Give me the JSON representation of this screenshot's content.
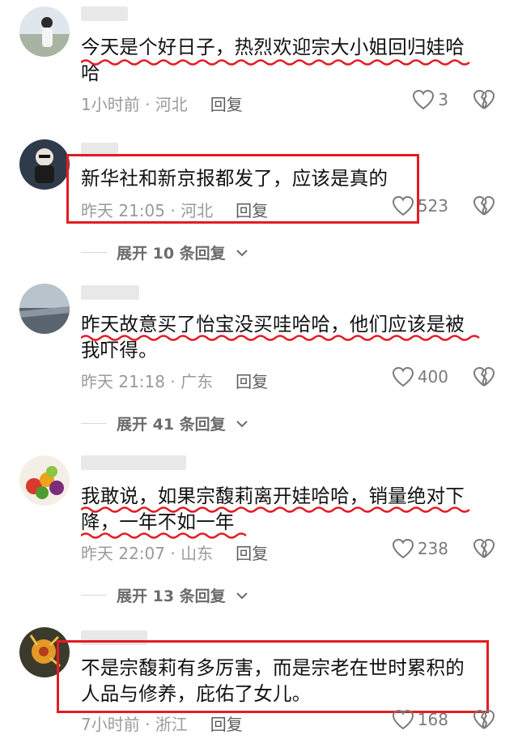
{
  "colors": {
    "highlight": "#e31c23",
    "text": "#111111",
    "meta": "#9a9a9a"
  },
  "icons": {
    "like": "heart-outline-icon",
    "dislike": "broken-heart-icon",
    "expand": "chevron-down-icon"
  },
  "comments": [
    {
      "text_line1": "今天是个好日子，热烈欢迎宗大小姐回归娃哈",
      "text_line2": "哈",
      "meta": "1小时前 · 河北",
      "reply": "回复",
      "likes": "3"
    },
    {
      "text": "新华社和新京报都发了，应该是真的",
      "meta": "昨天 21:05 · 河北",
      "reply": "回复",
      "likes": "523",
      "expand": "展开 10 条回复"
    },
    {
      "text_line1": "昨天故意买了怡宝没买哇哈哈，他们应该是被",
      "text_line2": "我吓得。",
      "meta": "昨天 21:18 · 广东",
      "reply": "回复",
      "likes": "400",
      "expand": "展开 41 条回复"
    },
    {
      "text_line1": "我敢说，如果宗馥莉离开娃哈哈，销量绝对下",
      "text_line2": "降，一年不如一年",
      "meta": "昨天 22:07 · 山东",
      "reply": "回复",
      "likes": "238",
      "expand": "展开 13 条回复"
    },
    {
      "text_line1": "不是宗馥莉有多厉害，而是宗老在世时累积的",
      "text_line2": "人品与修养，庇佑了女儿。",
      "meta": "7小时前 · 浙江",
      "reply": "回复",
      "likes": "168"
    }
  ]
}
